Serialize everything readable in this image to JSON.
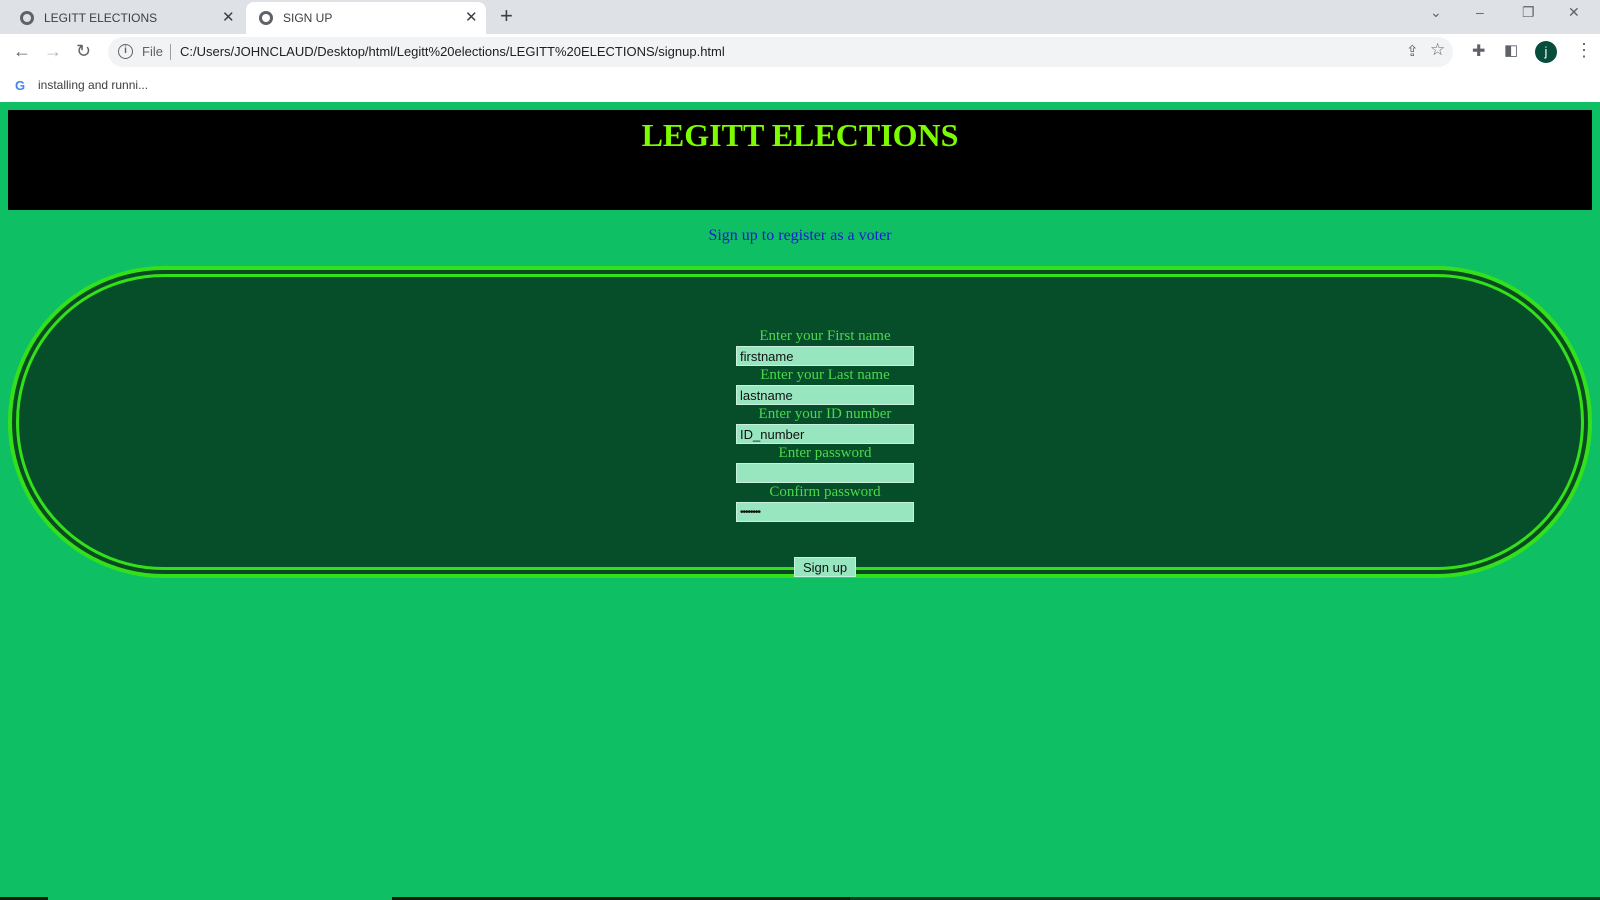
{
  "browser": {
    "tabs": [
      {
        "title": "LEGITT ELECTIONS"
      },
      {
        "title": "SIGN UP"
      }
    ],
    "new_tab_icon": "plus-icon",
    "window_controls": {
      "chevron": "⌄",
      "minimize": "–",
      "restore": "❐",
      "close": "✕"
    },
    "nav": {
      "back": "←",
      "forward": "→",
      "reload": "↻"
    },
    "address": {
      "scheme_label": "File",
      "url": "C:/Users/JOHNCLAUD/Desktop/html/Legitt%20elections/LEGITT%20ELECTIONS/signup.html"
    },
    "profile_initial": "j",
    "bookmarks": [
      {
        "icon": "G",
        "label": "installing and runni..."
      }
    ]
  },
  "page": {
    "title": "LEGITT ELECTIONS",
    "subtitle": "Sign up to register as a voter",
    "form": {
      "fields": [
        {
          "label": "Enter your First name",
          "value": "firstname",
          "type": "text"
        },
        {
          "label": "Enter your Last name",
          "value": "lastname",
          "type": "text"
        },
        {
          "label": "Enter your ID number",
          "value": "ID_number",
          "type": "text"
        },
        {
          "label": "Enter password",
          "value": "",
          "type": "password"
        },
        {
          "label": "Confirm password",
          "value": "••••••••",
          "type": "password"
        }
      ],
      "submit_label": "Sign up"
    }
  },
  "colors": {
    "page_background": "#0fbf63",
    "header_background": "#000000",
    "title_color": "#7cfc00",
    "subtitle_color": "#1b1bd1",
    "form_background": "#064d2a",
    "form_border": "#33e01c",
    "label_color": "#4cd84c",
    "input_background": "#98e6c0"
  }
}
